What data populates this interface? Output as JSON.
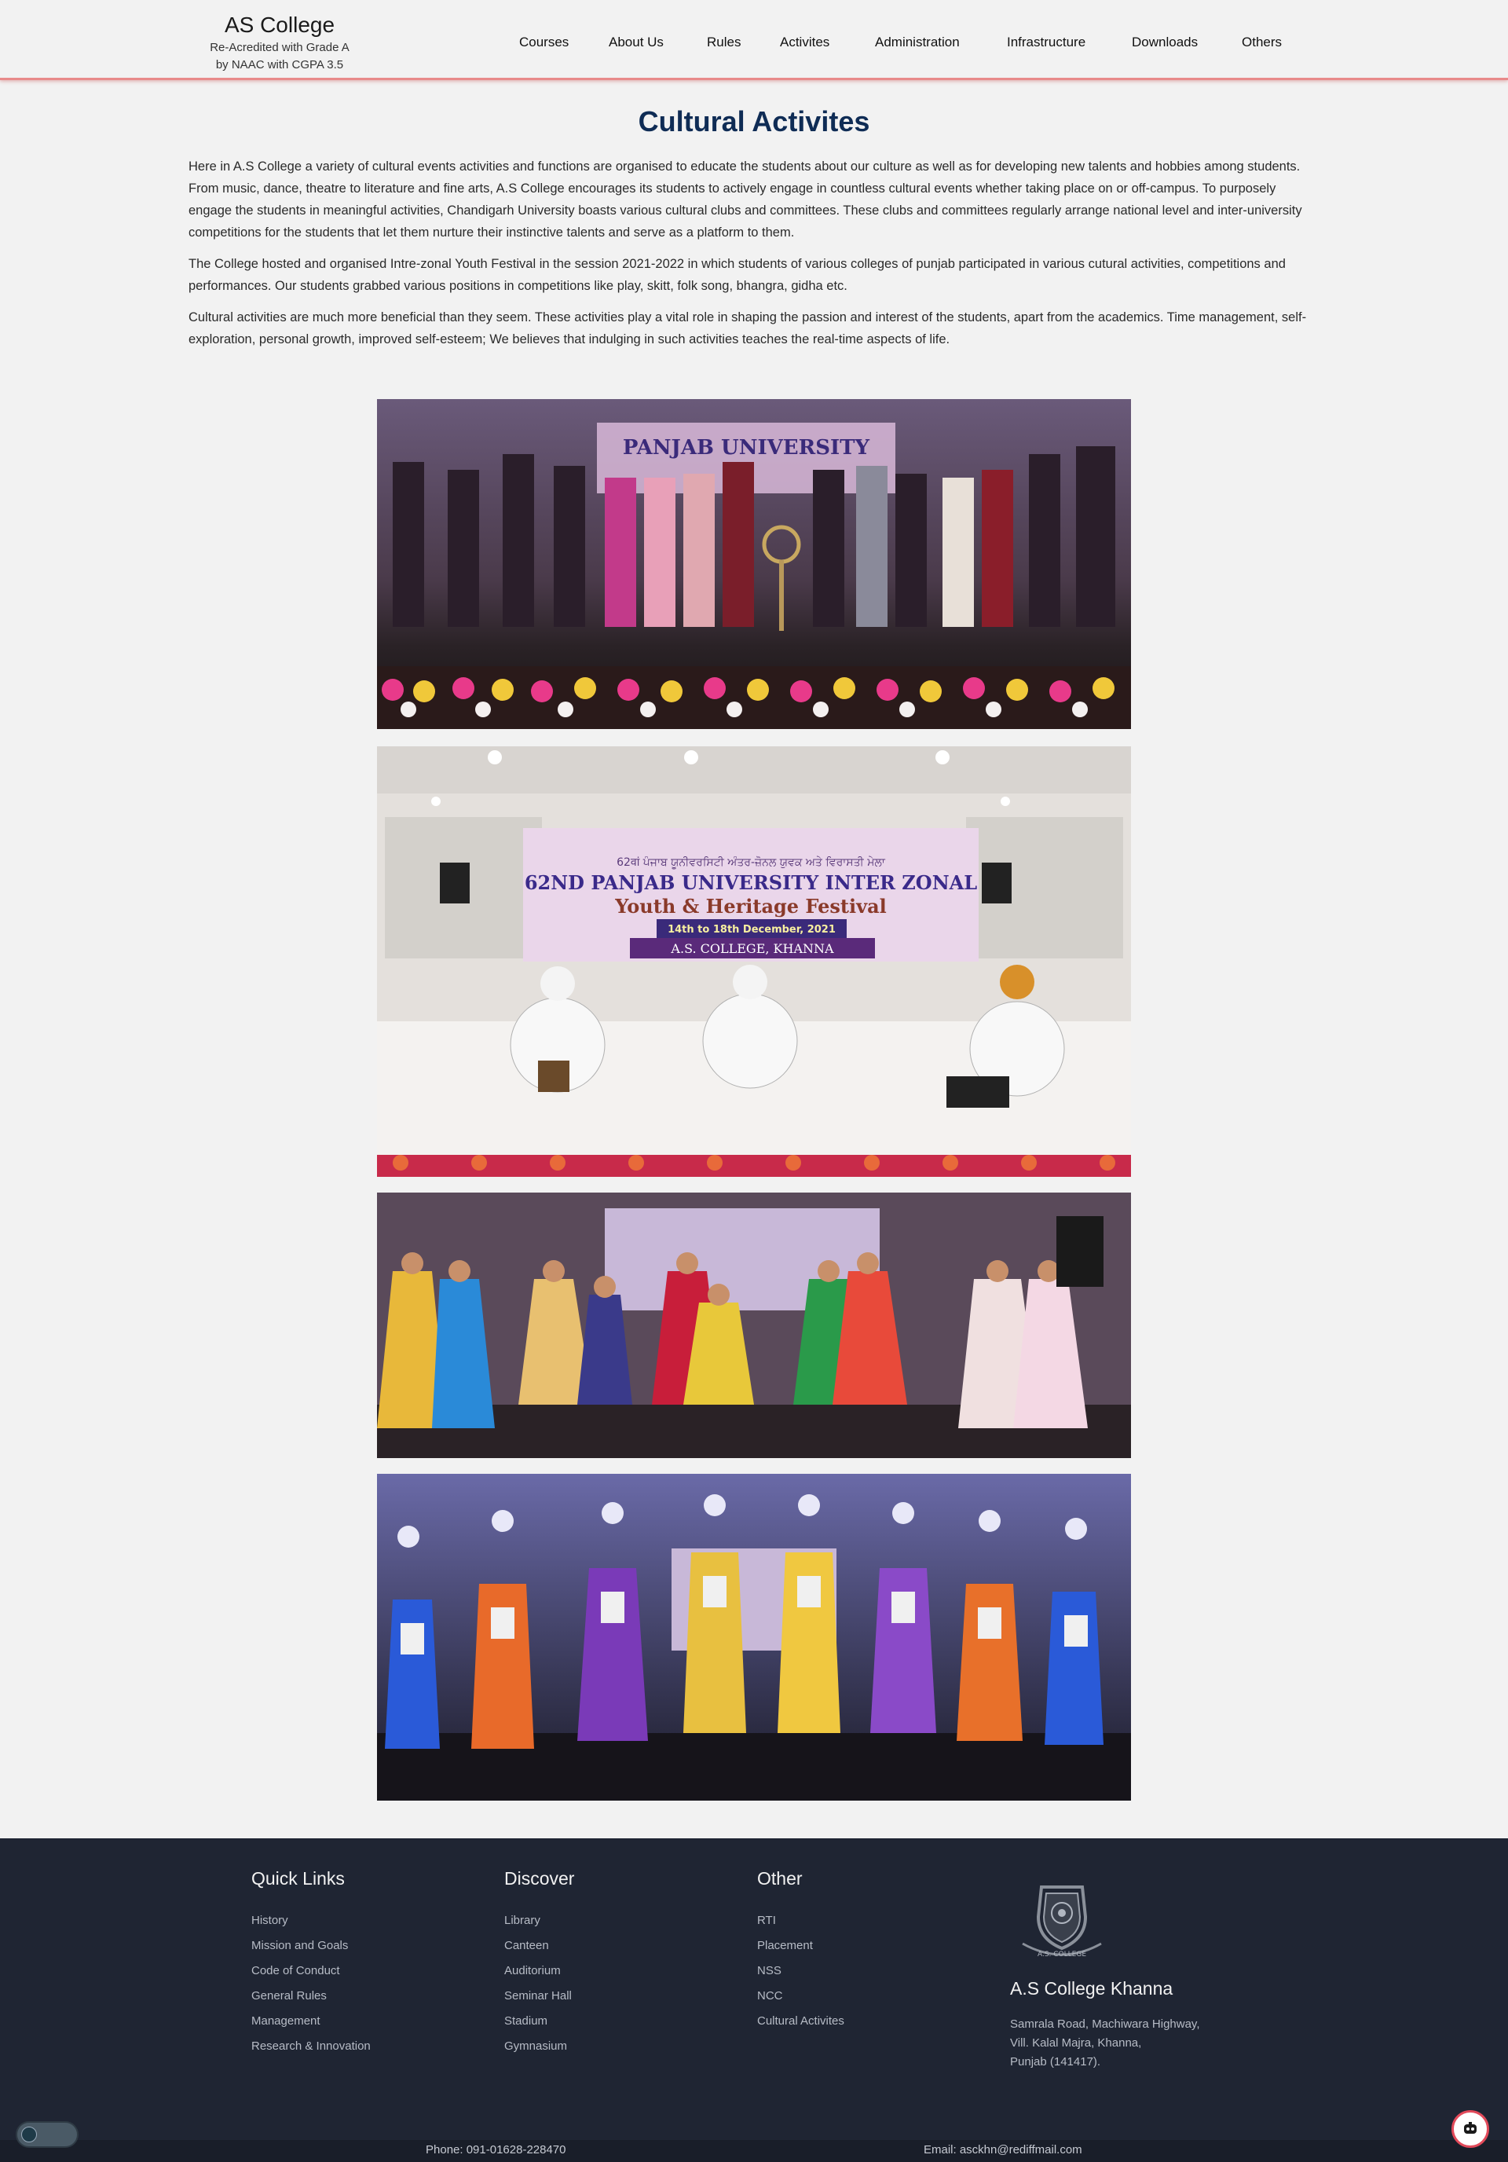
{
  "header": {
    "brand_name": "AS College",
    "brand_sub_1": "Re-Acredited with Grade A",
    "brand_sub_2": "by NAAC with CGPA 3.5",
    "nav": [
      "Courses",
      "About Us",
      "Rules",
      "Activites",
      "Administration",
      "Infrastructure",
      "Downloads",
      "Others"
    ]
  },
  "main": {
    "title": "Cultural Activites",
    "paragraphs": [
      "Here in A.S College a variety of cultural events activities and functions are organised to educate the students about our culture as well as for developing new talents and hobbies among students.",
      "From music, dance, theatre to literature and fine arts, A.S College encourages its students to actively engage in countless cultural events whether taking place on or off-campus. To purposely engage the students in meaningful activities, Chandigarh University boasts various cultural clubs and committees. These clubs and committees regularly arrange national level and inter-university competitions for the students that let them nurture their instinctive talents and serve as a platform to them.",
      "The College hosted and organised Intre-zonal Youth Festival in the session 2021-2022 in which students of various colleges of punjab participated in various cutural activities, competitions and performances. Our students grabbed various positions in competitions like play, skitt, folk song, bhangra, gidha etc.",
      "Cultural activities are much more beneficial than they seem. These activities play a vital role in shaping the passion and interest of the students, apart from the academics. Time management, self-exploration, personal growth, improved self-esteem; We believes that indulging in such activities teaches the real-time aspects of life."
    ],
    "banner": {
      "line1": "62वां ਪੰਜਾਬ ਯੂਨੀਵਰਸਿਟੀ ਅੰਤਰ-ਜ਼ੋਨਲ ਯੁਵਕ ਅਤੇ ਵਿਰਾਸਤੀ ਮੇਲਾ",
      "line2": "62ND PANJAB UNIVERSITY INTER ZONAL",
      "line3": "Youth & Heritage Festival",
      "line4": "14th to 18th December, 2021",
      "line5": "A.S. COLLEGE, KHANNA"
    },
    "photo_icons": [
      "photo-lamp-lighting",
      "photo-music-performance",
      "photo-giddha-dance",
      "photo-bhangra-dance"
    ]
  },
  "footer": {
    "quick_links": {
      "heading": "Quick Links",
      "items": [
        "History",
        "Mission and Goals",
        "Code of Conduct",
        "General Rules",
        "Management",
        "Research & Innovation"
      ]
    },
    "discover": {
      "heading": "Discover",
      "items": [
        "Library",
        "Canteen",
        "Auditorium",
        "Seminar Hall",
        "Stadium",
        "Gymnasium"
      ]
    },
    "other": {
      "heading": "Other",
      "items": [
        "RTI",
        "Placement",
        "NSS",
        "NCC",
        "Cultural Activites"
      ]
    },
    "college": {
      "name": "A.S College Khanna",
      "address_1": "Samrala Road, Machiwara Highway,",
      "address_2": "Vill. Kalal Majra, Khanna,",
      "address_3": "Punjab (141417).",
      "crest_text": "A.S. COLLEGE"
    },
    "phone": "Phone: 091-01628-228470",
    "email": "Email: asckhn@rediffmail.com"
  },
  "colors": {
    "title": "#0f2c55",
    "header_border": "#e88a8a",
    "footer_bg": "#1f2533",
    "chat_accent": "#e24a5a"
  }
}
